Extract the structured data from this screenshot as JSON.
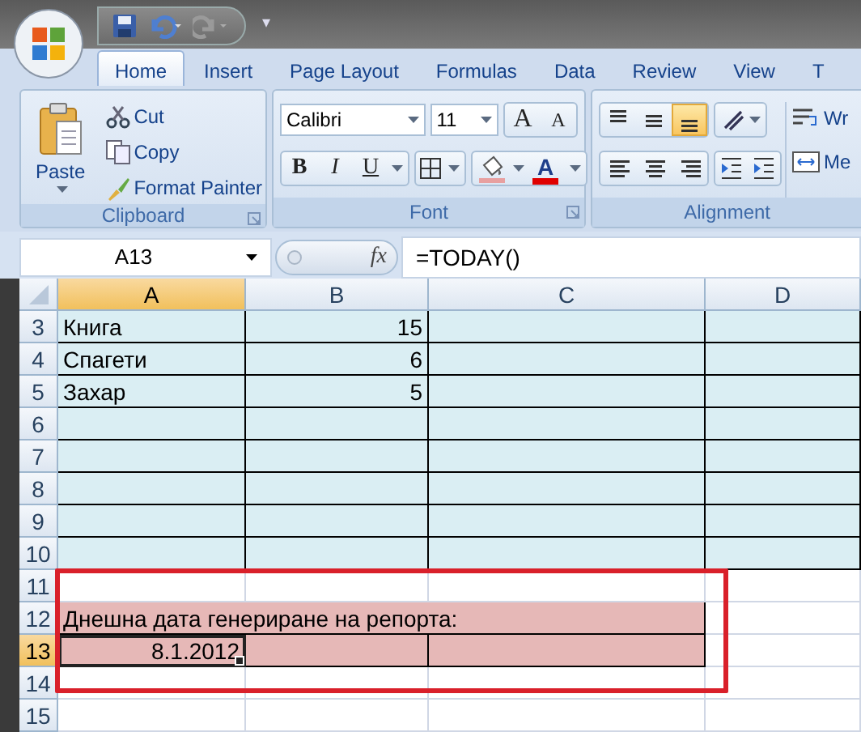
{
  "quick_access": {
    "customize": "▾"
  },
  "tabs": [
    {
      "label": "Home",
      "selected": true
    },
    {
      "label": "Insert",
      "selected": false
    },
    {
      "label": "Page Layout",
      "selected": false
    },
    {
      "label": "Formulas",
      "selected": false
    },
    {
      "label": "Data",
      "selected": false
    },
    {
      "label": "Review",
      "selected": false
    },
    {
      "label": "View",
      "selected": false
    },
    {
      "label": "T",
      "selected": false
    }
  ],
  "clipboard": {
    "paste": "Paste",
    "cut": "Cut",
    "copy": "Copy",
    "format_painter": "Format Painter",
    "label": "Clipboard"
  },
  "font": {
    "name": "Calibri",
    "size": "11",
    "grow": "A",
    "shrink": "A",
    "bold": "B",
    "italic": "I",
    "underline": "U",
    "font_color": "A",
    "label": "Font"
  },
  "alignment": {
    "vertical": [
      {
        "kind": "top",
        "selected": false
      },
      {
        "kind": "middle",
        "selected": false
      },
      {
        "kind": "bottom",
        "selected": true
      }
    ],
    "horizontal": [
      {
        "kind": "left",
        "selected": false
      },
      {
        "kind": "center",
        "selected": false
      },
      {
        "kind": "right",
        "selected": false
      }
    ],
    "wrap": "Wr",
    "merge": "Me",
    "label": "Alignment"
  },
  "formula_bar": {
    "name_box": "A13",
    "fx": "fx",
    "formula": "=TODAY()"
  },
  "sheet": {
    "columns": [
      {
        "label": "A",
        "selected": true
      },
      {
        "label": "B",
        "selected": false
      },
      {
        "label": "C",
        "selected": false
      },
      {
        "label": "D",
        "selected": false
      }
    ],
    "rows": [
      {
        "header": "3",
        "selected": false,
        "kind": "band",
        "cells": [
          {
            "kind": "text",
            "text": "Книга",
            "selected": false
          },
          {
            "kind": "number",
            "text": "15",
            "selected": false
          }
        ]
      },
      {
        "header": "4",
        "selected": false,
        "kind": "band",
        "cells": [
          {
            "kind": "text",
            "text": "Спагети",
            "selected": false
          },
          {
            "kind": "number",
            "text": "6",
            "selected": false
          }
        ]
      },
      {
        "header": "5",
        "selected": false,
        "kind": "band",
        "cells": [
          {
            "kind": "text",
            "text": "Захар",
            "selected": false
          },
          {
            "kind": "number",
            "text": "5",
            "selected": false
          }
        ]
      },
      {
        "header": "6",
        "selected": false,
        "kind": "band"
      },
      {
        "header": "7",
        "selected": false,
        "kind": "band"
      },
      {
        "header": "8",
        "selected": false,
        "kind": "band"
      },
      {
        "header": "9",
        "selected": false,
        "kind": "band"
      },
      {
        "header": "10",
        "selected": false,
        "kind": "band"
      },
      {
        "header": "11",
        "selected": false,
        "kind": "plain"
      },
      {
        "header": "12",
        "selected": false,
        "kind": "highlight",
        "cells": [
          {
            "kind": "merged",
            "text": "Днешна дата генериране на репорта:",
            "selected": false
          }
        ]
      },
      {
        "header": "13",
        "selected": true,
        "kind": "highlight",
        "cells": [
          {
            "kind": "number",
            "text": "8.1.2012",
            "selected": true
          }
        ]
      },
      {
        "header": "14",
        "selected": false,
        "kind": "plain"
      },
      {
        "header": "15",
        "selected": false,
        "kind": "plain"
      }
    ]
  },
  "annotation_frame": true
}
